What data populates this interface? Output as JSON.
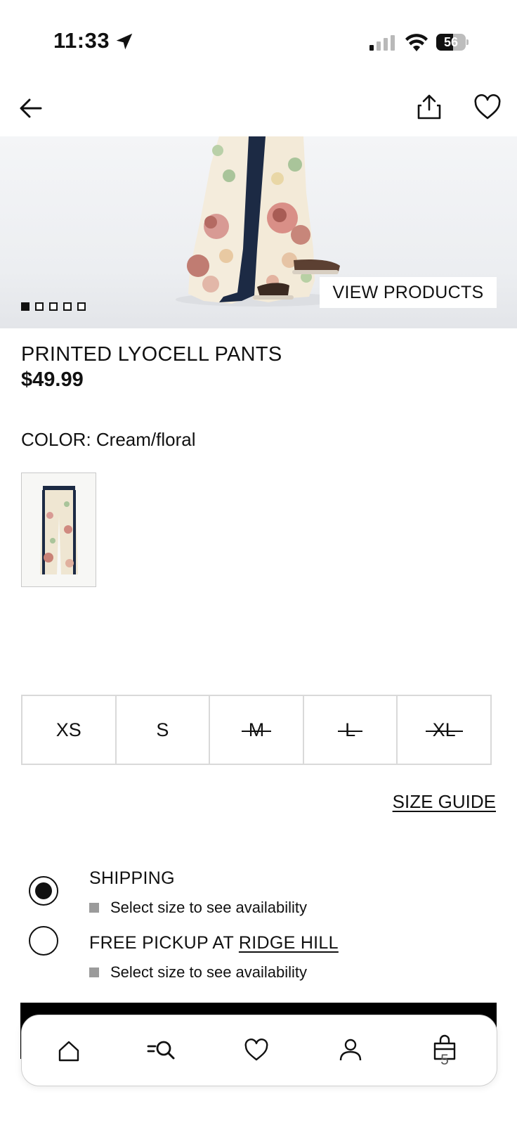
{
  "status_bar": {
    "time": "11:33",
    "battery": "56",
    "battery_level": 0.56,
    "signal_bars_active": 1,
    "signal_bars_total": 4
  },
  "header": {
    "back_icon": "arrow-left-icon",
    "share_icon": "share-icon",
    "wishlist_icon": "heart-icon"
  },
  "hero": {
    "view_products_label": "VIEW PRODUCTS",
    "total_images": 5,
    "active_image": 1
  },
  "product": {
    "title": "PRINTED LYOCELL PANTS",
    "price": "$49.99",
    "color_label": "COLOR: Cream/floral"
  },
  "sizes": [
    {
      "label": "XS",
      "available": true
    },
    {
      "label": "S",
      "available": true
    },
    {
      "label": "M",
      "available": false
    },
    {
      "label": "L",
      "available": false
    },
    {
      "label": "XL",
      "available": false
    }
  ],
  "size_guide_label": "SIZE GUIDE",
  "delivery": {
    "shipping": {
      "label": "SHIPPING",
      "availability": "Select size to see availability",
      "selected": true
    },
    "pickup": {
      "label_prefix": "FREE PICKUP AT ",
      "store": "RIDGE HILL",
      "availability": "Select size to see availability",
      "selected": false
    }
  },
  "bottom_nav": {
    "items": [
      "home-icon",
      "search-icon",
      "heart-icon",
      "account-icon",
      "bag-icon"
    ],
    "bag_count": "5"
  },
  "colors": {
    "accent": "#111111",
    "border": "#d9d9d9",
    "indicator_gray": "#9b9b9b"
  }
}
